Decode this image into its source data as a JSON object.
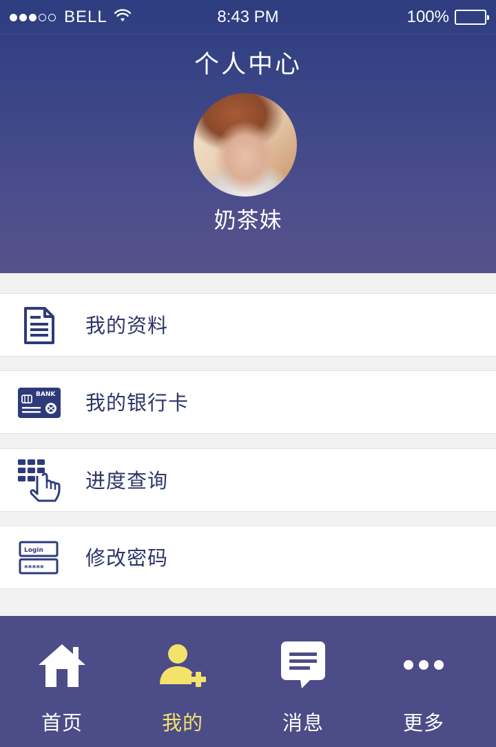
{
  "status_bar": {
    "carrier": "BELL",
    "time": "8:43 PM",
    "battery": "100%"
  },
  "header": {
    "title": "个人中心",
    "username": "奶茶妹"
  },
  "menu": {
    "items": [
      {
        "label": "我的资料",
        "icon": "document-icon"
      },
      {
        "label": "我的银行卡",
        "icon": "bank-card-icon",
        "icon_text": "BANK"
      },
      {
        "label": "进度查询",
        "icon": "keypad-touch-icon"
      },
      {
        "label": "修改密码",
        "icon": "login-password-icon",
        "icon_text": "Login",
        "icon_mask": "*****"
      }
    ]
  },
  "tabbar": {
    "tabs": [
      {
        "label": "首页",
        "icon": "home-icon",
        "active": false
      },
      {
        "label": "我的",
        "icon": "user-add-icon",
        "active": true
      },
      {
        "label": "消息",
        "icon": "message-icon",
        "active": false
      },
      {
        "label": "更多",
        "icon": "more-icon",
        "active": false
      }
    ]
  },
  "colors": {
    "header_top": "#2d3d80",
    "header_bottom": "#565289",
    "menu_text": "#2e3566",
    "icon_navy": "#2e3a7a",
    "tabbar_bg": "#4c4c88",
    "tab_active": "#f3e36b",
    "tab_inactive": "#ffffff"
  }
}
